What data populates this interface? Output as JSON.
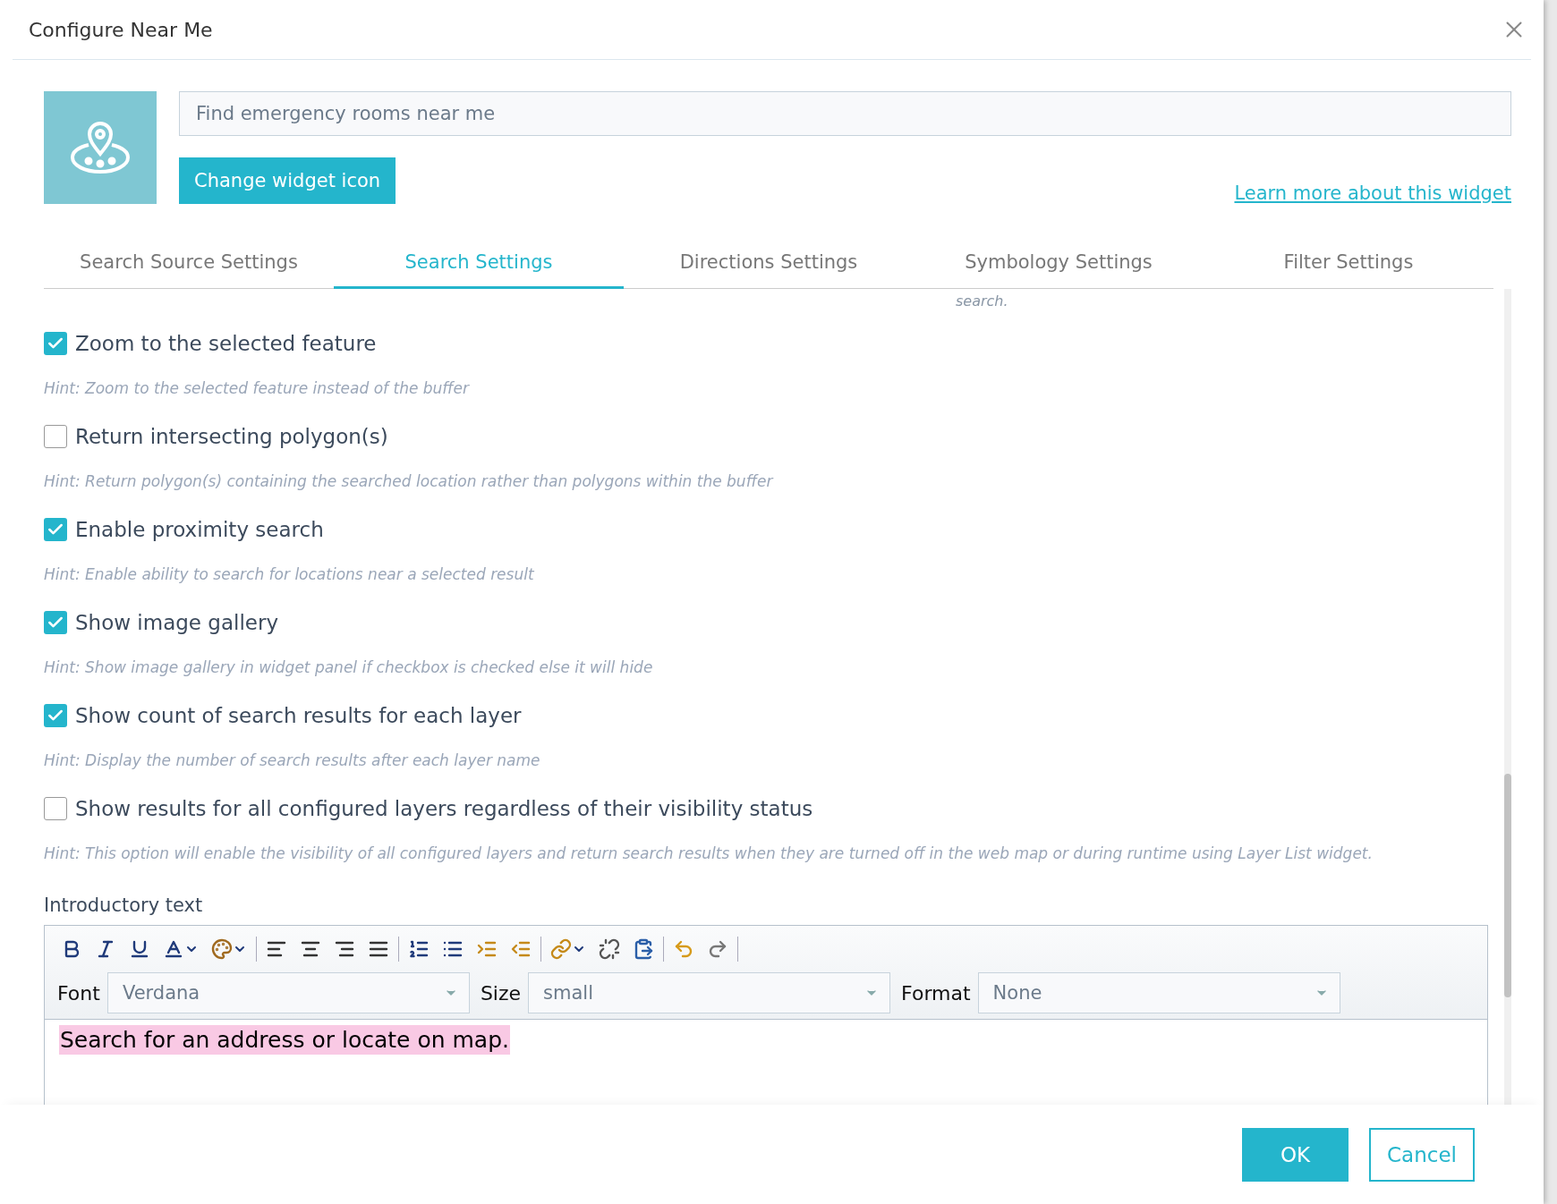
{
  "dialog": {
    "title": "Configure Near Me"
  },
  "widget": {
    "label_value": "Find emergency rooms near me",
    "change_icon_button": "Change widget icon",
    "learn_more_link": "Learn more about this widget"
  },
  "tabs": [
    {
      "label": "Search Source Settings",
      "selected": false
    },
    {
      "label": "Search Settings",
      "selected": true
    },
    {
      "label": "Directions Settings",
      "selected": false
    },
    {
      "label": "Symbology Settings",
      "selected": false
    },
    {
      "label": "Filter Settings",
      "selected": false
    }
  ],
  "clipped_text": "search.",
  "options": [
    {
      "label": "Zoom to the selected feature",
      "checked": true,
      "hint": "Hint: Zoom to the selected feature instead of the buffer"
    },
    {
      "label": "Return intersecting polygon(s)",
      "checked": false,
      "hint": "Hint: Return polygon(s) containing the searched location rather than polygons within the buffer"
    },
    {
      "label": "Enable proximity search",
      "checked": true,
      "hint": "Hint: Enable ability to search for locations near a selected result"
    },
    {
      "label": "Show image gallery",
      "checked": true,
      "hint": "Hint: Show image gallery in widget panel if checkbox is checked else it will hide"
    },
    {
      "label": "Show count of search results for each layer",
      "checked": true,
      "hint": "Hint: Display the number of search results after each layer name"
    },
    {
      "label": "Show results for all configured layers regardless of their visibility status",
      "checked": false,
      "hint": "Hint: This option will enable the visibility of all configured layers and return search results when they are turned off in the web map or during runtime using Layer List widget."
    }
  ],
  "intro": {
    "label": "Introductory text",
    "selects": [
      {
        "label": "Font",
        "value": "Verdana"
      },
      {
        "label": "Size",
        "value": "small"
      },
      {
        "label": "Format",
        "value": "None"
      }
    ],
    "content": "Search for an address or locate on map."
  },
  "buttons": [
    {
      "label": "OK",
      "kind": "primary"
    },
    {
      "label": "Cancel",
      "kind": "secondary"
    }
  ]
}
